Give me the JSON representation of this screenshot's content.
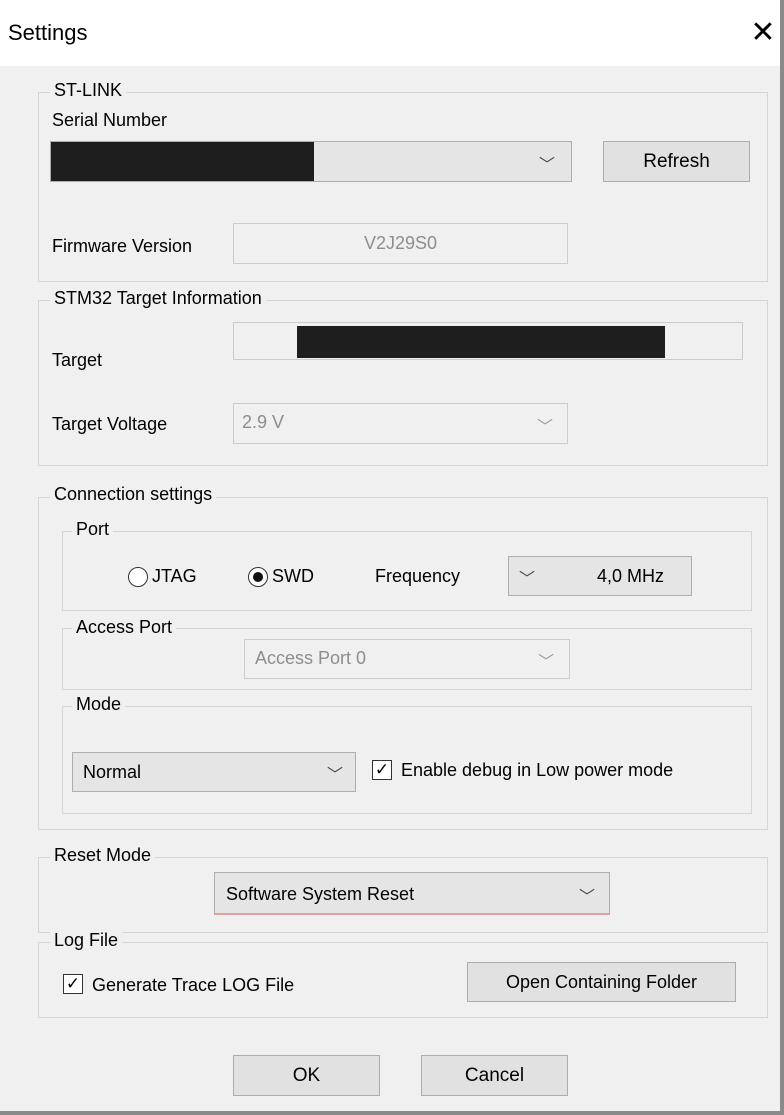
{
  "window": {
    "title": "Settings"
  },
  "stlink": {
    "legend": "ST-LINK",
    "serial_label": "Serial Number",
    "refresh_label": "Refresh",
    "firmware_label": "Firmware Version",
    "firmware_value": "V2J29S0"
  },
  "target_info": {
    "legend": "STM32 Target Information",
    "target_label": "Target",
    "voltage_label": "Target Voltage",
    "voltage_value": "2.9 V"
  },
  "connection": {
    "legend": "Connection settings",
    "port": {
      "legend": "Port",
      "jtag_label": "JTAG",
      "swd_label": "SWD",
      "selected": "SWD",
      "frequency_label": "Frequency",
      "frequency_value": "4,0 MHz"
    },
    "access_port": {
      "legend": "Access Port",
      "value": "Access Port 0"
    },
    "mode": {
      "legend": "Mode",
      "value": "Normal",
      "low_power_label": "Enable debug in Low power mode",
      "low_power_checked": true
    }
  },
  "reset_mode": {
    "legend": "Reset Mode",
    "value": "Software System Reset"
  },
  "log_file": {
    "legend": "Log File",
    "generate_label": "Generate Trace LOG File",
    "generate_checked": true,
    "open_folder_label": "Open Containing Folder"
  },
  "footer": {
    "ok_label": "OK",
    "cancel_label": "Cancel"
  },
  "icons": {
    "close": "close-icon",
    "dropdown": "chevron-down-icon",
    "checkmark": "checkmark-icon"
  }
}
